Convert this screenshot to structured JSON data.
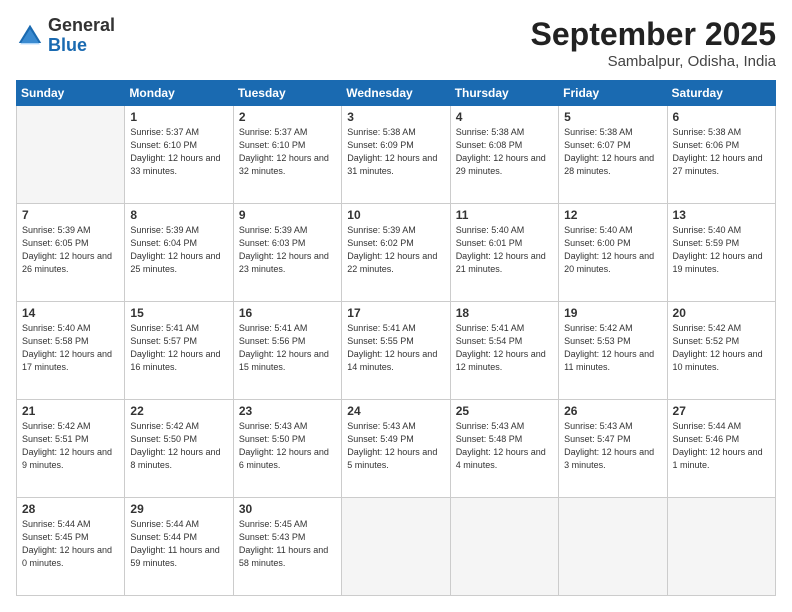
{
  "logo": {
    "general": "General",
    "blue": "Blue"
  },
  "header": {
    "month": "September 2025",
    "location": "Sambalpur, Odisha, India"
  },
  "weekdays": [
    "Sunday",
    "Monday",
    "Tuesday",
    "Wednesday",
    "Thursday",
    "Friday",
    "Saturday"
  ],
  "weeks": [
    [
      {
        "day": "",
        "empty": true
      },
      {
        "day": "1",
        "sunrise": "5:37 AM",
        "sunset": "6:10 PM",
        "daylight": "12 hours and 33 minutes."
      },
      {
        "day": "2",
        "sunrise": "5:37 AM",
        "sunset": "6:10 PM",
        "daylight": "12 hours and 32 minutes."
      },
      {
        "day": "3",
        "sunrise": "5:38 AM",
        "sunset": "6:09 PM",
        "daylight": "12 hours and 31 minutes."
      },
      {
        "day": "4",
        "sunrise": "5:38 AM",
        "sunset": "6:08 PM",
        "daylight": "12 hours and 29 minutes."
      },
      {
        "day": "5",
        "sunrise": "5:38 AM",
        "sunset": "6:07 PM",
        "daylight": "12 hours and 28 minutes."
      },
      {
        "day": "6",
        "sunrise": "5:38 AM",
        "sunset": "6:06 PM",
        "daylight": "12 hours and 27 minutes."
      }
    ],
    [
      {
        "day": "7",
        "sunrise": "5:39 AM",
        "sunset": "6:05 PM",
        "daylight": "12 hours and 26 minutes."
      },
      {
        "day": "8",
        "sunrise": "5:39 AM",
        "sunset": "6:04 PM",
        "daylight": "12 hours and 25 minutes."
      },
      {
        "day": "9",
        "sunrise": "5:39 AM",
        "sunset": "6:03 PM",
        "daylight": "12 hours and 23 minutes."
      },
      {
        "day": "10",
        "sunrise": "5:39 AM",
        "sunset": "6:02 PM",
        "daylight": "12 hours and 22 minutes."
      },
      {
        "day": "11",
        "sunrise": "5:40 AM",
        "sunset": "6:01 PM",
        "daylight": "12 hours and 21 minutes."
      },
      {
        "day": "12",
        "sunrise": "5:40 AM",
        "sunset": "6:00 PM",
        "daylight": "12 hours and 20 minutes."
      },
      {
        "day": "13",
        "sunrise": "5:40 AM",
        "sunset": "5:59 PM",
        "daylight": "12 hours and 19 minutes."
      }
    ],
    [
      {
        "day": "14",
        "sunrise": "5:40 AM",
        "sunset": "5:58 PM",
        "daylight": "12 hours and 17 minutes."
      },
      {
        "day": "15",
        "sunrise": "5:41 AM",
        "sunset": "5:57 PM",
        "daylight": "12 hours and 16 minutes."
      },
      {
        "day": "16",
        "sunrise": "5:41 AM",
        "sunset": "5:56 PM",
        "daylight": "12 hours and 15 minutes."
      },
      {
        "day": "17",
        "sunrise": "5:41 AM",
        "sunset": "5:55 PM",
        "daylight": "12 hours and 14 minutes."
      },
      {
        "day": "18",
        "sunrise": "5:41 AM",
        "sunset": "5:54 PM",
        "daylight": "12 hours and 12 minutes."
      },
      {
        "day": "19",
        "sunrise": "5:42 AM",
        "sunset": "5:53 PM",
        "daylight": "12 hours and 11 minutes."
      },
      {
        "day": "20",
        "sunrise": "5:42 AM",
        "sunset": "5:52 PM",
        "daylight": "12 hours and 10 minutes."
      }
    ],
    [
      {
        "day": "21",
        "sunrise": "5:42 AM",
        "sunset": "5:51 PM",
        "daylight": "12 hours and 9 minutes."
      },
      {
        "day": "22",
        "sunrise": "5:42 AM",
        "sunset": "5:50 PM",
        "daylight": "12 hours and 8 minutes."
      },
      {
        "day": "23",
        "sunrise": "5:43 AM",
        "sunset": "5:50 PM",
        "daylight": "12 hours and 6 minutes."
      },
      {
        "day": "24",
        "sunrise": "5:43 AM",
        "sunset": "5:49 PM",
        "daylight": "12 hours and 5 minutes."
      },
      {
        "day": "25",
        "sunrise": "5:43 AM",
        "sunset": "5:48 PM",
        "daylight": "12 hours and 4 minutes."
      },
      {
        "day": "26",
        "sunrise": "5:43 AM",
        "sunset": "5:47 PM",
        "daylight": "12 hours and 3 minutes."
      },
      {
        "day": "27",
        "sunrise": "5:44 AM",
        "sunset": "5:46 PM",
        "daylight": "12 hours and 1 minute."
      }
    ],
    [
      {
        "day": "28",
        "sunrise": "5:44 AM",
        "sunset": "5:45 PM",
        "daylight": "12 hours and 0 minutes."
      },
      {
        "day": "29",
        "sunrise": "5:44 AM",
        "sunset": "5:44 PM",
        "daylight": "11 hours and 59 minutes."
      },
      {
        "day": "30",
        "sunrise": "5:45 AM",
        "sunset": "5:43 PM",
        "daylight": "11 hours and 58 minutes."
      },
      {
        "day": "",
        "empty": true
      },
      {
        "day": "",
        "empty": true
      },
      {
        "day": "",
        "empty": true
      },
      {
        "day": "",
        "empty": true
      }
    ]
  ]
}
